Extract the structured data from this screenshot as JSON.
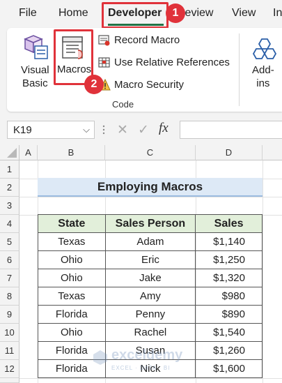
{
  "menu": {
    "tabs": [
      "File",
      "Home",
      "Developer",
      "Review",
      "View",
      "In"
    ],
    "active_tab": "Developer",
    "accent_color": "#217346",
    "highlight_color": "#e0323a"
  },
  "ribbon": {
    "visual_basic_label": "Visual\nBasic",
    "macros_label": "Macros",
    "record_macro_label": "Record Macro",
    "relative_refs_label": "Use Relative References",
    "macro_security_label": "Macro Security",
    "group_label": "Code",
    "addins_label": "Add-\nins"
  },
  "callouts": {
    "step1": "1",
    "step2": "2"
  },
  "formula_bar": {
    "name_box": "K19",
    "fx_label": "fx",
    "formula": ""
  },
  "sheet": {
    "columns": [
      "A",
      "B",
      "C",
      "D"
    ],
    "rows": [
      "1",
      "2",
      "3",
      "4",
      "5",
      "6",
      "7",
      "8",
      "9",
      "10",
      "11",
      "12"
    ],
    "title": "Employing Macros",
    "table": {
      "headers": [
        "State",
        "Sales Person",
        "Sales"
      ],
      "rows": [
        [
          "Texas",
          "Adam",
          "$1,140"
        ],
        [
          "Ohio",
          "Eric",
          "$1,250"
        ],
        [
          "Ohio",
          "Jake",
          "$1,320"
        ],
        [
          "Texas",
          "Amy",
          "$980"
        ],
        [
          "Florida",
          "Penny",
          "$890"
        ],
        [
          "Ohio",
          "Rachel",
          "$1,540"
        ],
        [
          "Florida",
          "Susan",
          "$1,260"
        ],
        [
          "Florida",
          "Nick",
          "$1,600"
        ]
      ]
    }
  },
  "watermark": {
    "name": "exceldemy",
    "tagline": "EXCEL · DATA · BI"
  }
}
